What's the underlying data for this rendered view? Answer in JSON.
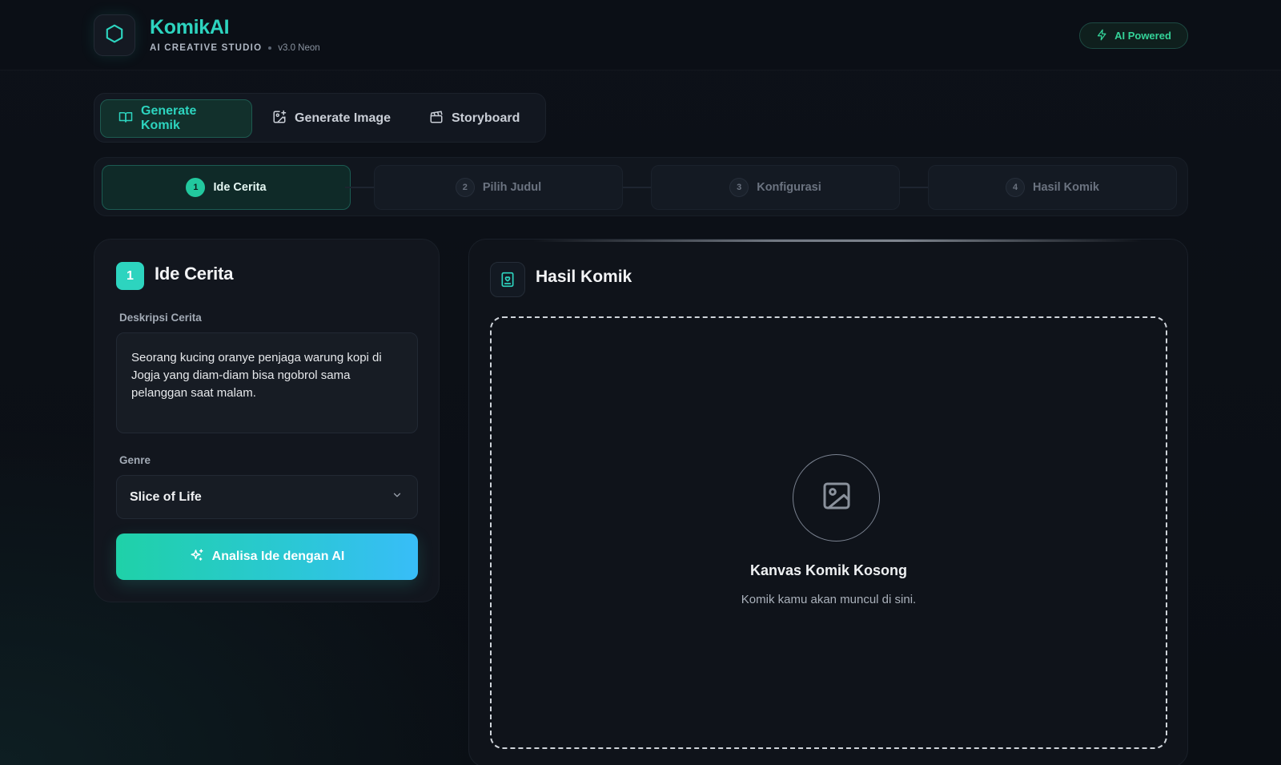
{
  "brand": {
    "title": "KomikAI",
    "subtitle": "AI CREATIVE STUDIO",
    "version": "v3.0 Neon",
    "badge": "AI Powered"
  },
  "tabs": [
    {
      "label": "Generate Komik",
      "icon": "book-open-icon",
      "active": true
    },
    {
      "label": "Generate Image",
      "icon": "image-plus-icon",
      "active": false
    },
    {
      "label": "Storyboard",
      "icon": "clapperboard-icon",
      "active": false
    }
  ],
  "steps": [
    {
      "num": "1",
      "label": "Ide Cerita",
      "active": true
    },
    {
      "num": "2",
      "label": "Pilih Judul",
      "active": false
    },
    {
      "num": "3",
      "label": "Konfigurasi",
      "active": false
    },
    {
      "num": "4",
      "label": "Hasil Komik",
      "active": false
    }
  ],
  "idea_card": {
    "badge": "1",
    "title": "Ide Cerita",
    "description_label": "Deskripsi Cerita",
    "description_value": "Seorang kucing oranye penjaga warung kopi di Jogja yang diam-diam bisa ngobrol sama pelanggan saat malam.",
    "genre_label": "Genre",
    "genre_value": "Slice of Life",
    "cta_label": "Analisa Ide dengan AI"
  },
  "result_card": {
    "title": "Hasil Komik",
    "empty_title": "Kanvas Komik Kosong",
    "empty_subtitle": "Komik kamu akan muncul di sini."
  },
  "colors": {
    "accent": "#2dd4bf",
    "background": "#0b0f15",
    "cta_start": "#1fd1a8",
    "cta_end": "#38bdf8"
  }
}
